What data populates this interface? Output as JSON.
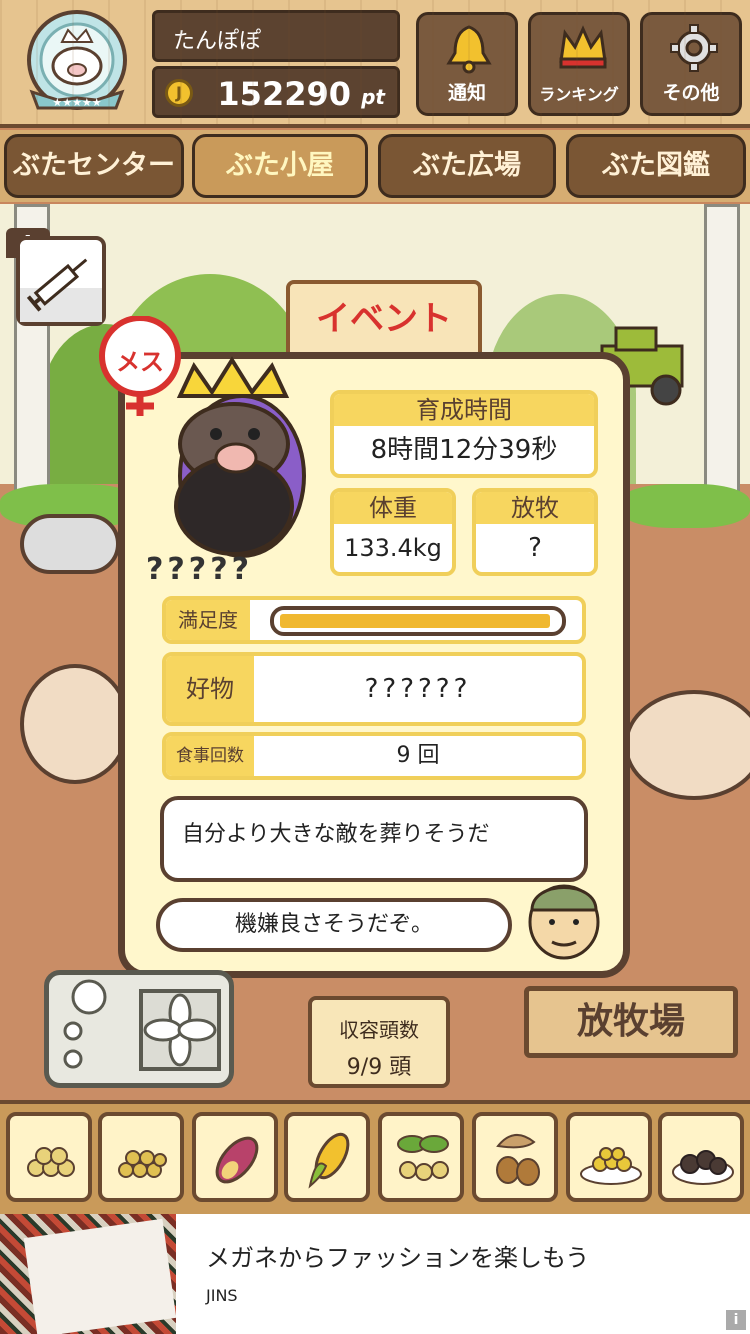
{
  "header": {
    "player_name": "たんぽぽ",
    "points": "152290",
    "points_unit": "pt",
    "coin_symbol": "J",
    "buttons": [
      {
        "label": "通知",
        "icon": "bell-icon"
      },
      {
        "label": "ランキング",
        "icon": "crown-icon"
      },
      {
        "label": "その他",
        "icon": "gear-icon"
      }
    ]
  },
  "tabs": [
    {
      "label": "ぶたセンター",
      "active": false
    },
    {
      "label": "ぶた小屋",
      "active": true
    },
    {
      "label": "ぶた広場",
      "active": false
    },
    {
      "label": "ぶた図鑑",
      "active": false
    }
  ],
  "scene": {
    "syringe_count": "4",
    "event_sign": "イベント"
  },
  "pig_info": {
    "gender_badge": "メス",
    "name": "?????",
    "raising_time_label": "育成時間",
    "raising_time": "8時間12分39秒",
    "weight_label": "体重",
    "weight": "133.4kg",
    "grazing_label": "放牧",
    "grazing": "?",
    "satisfaction_label": "満足度",
    "satisfaction": 0.98,
    "favorite_label": "好物",
    "favorite": "??????",
    "meals_label": "食事回数",
    "meals": "9 回",
    "comment": "自分より大きな敵を葬りそうだ",
    "mood": "機嫌良さそうだぞ。"
  },
  "bottom": {
    "capacity_label": "収容頭数",
    "capacity_value": "9/9 頭",
    "ranch_sign": "放牧場"
  },
  "food_items": [
    "soybeans-icon",
    "mixed-grain-icon",
    "sweet-potato-icon",
    "corn-icon",
    "leafy-beans-icon",
    "acorn-icon",
    "grain-plate-icon",
    "truffle-plate-icon"
  ],
  "ad": {
    "title": "メガネからファッションを楽しもう",
    "sponsor": "JINS",
    "info_symbol": "i"
  },
  "colors": {
    "wood_dark": "#5a4030",
    "card_yellow": "#f7d65f",
    "panel_cream": "#fff7cc",
    "satisfaction_fill": "#f0b830",
    "event_red": "#d8322e"
  }
}
